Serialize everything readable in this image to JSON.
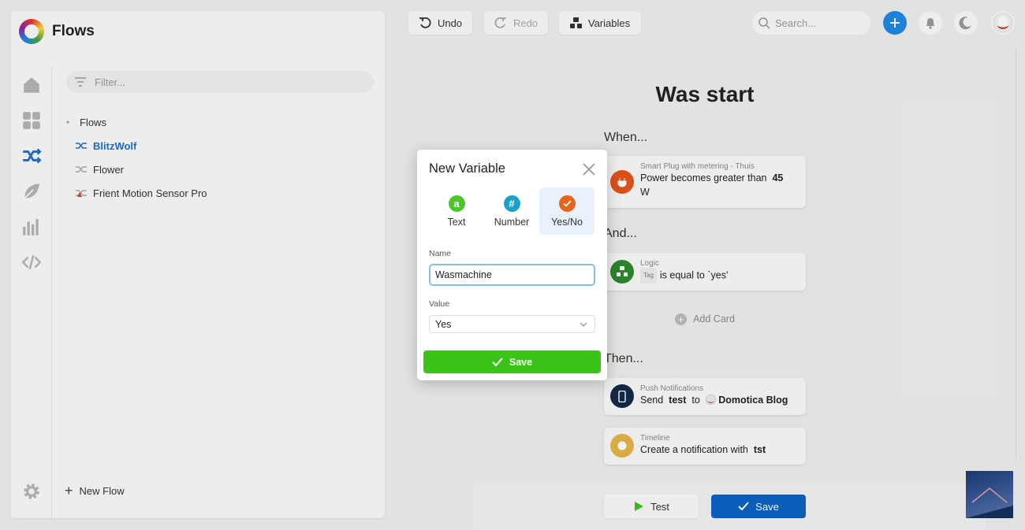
{
  "app": {
    "title": "Flows"
  },
  "sidebar": {
    "nav": [
      "home-icon",
      "dashboard-icon",
      "flows-icon",
      "energy-icon",
      "insights-icon",
      "devtools-icon"
    ],
    "settings": "gear-icon",
    "filter_placeholder": "Filter...",
    "tree_root": "Flows",
    "flows": [
      {
        "label": "BlitzWolf",
        "active": true
      },
      {
        "label": "Flower",
        "active": false
      },
      {
        "label": "Frient Motion Sensor Pro",
        "active": false
      }
    ],
    "new_flow_label": "New Flow"
  },
  "toolbar": {
    "undo_label": "Undo",
    "redo_label": "Redo",
    "variables_label": "Variables",
    "search_placeholder": "Search..."
  },
  "flow": {
    "title": "Was start",
    "when_label": "When...",
    "and_label": "And...",
    "then_label": "Then...",
    "when_card": {
      "sub": "Smart Plug with metering - Thuis",
      "text": "Power becomes greater than",
      "value": "45",
      "unit": "W"
    },
    "and_card": {
      "sub": "Logic",
      "tag": "Tag",
      "text": "is equal to `yes'"
    },
    "add_card_label": "Add Card",
    "then_cards": [
      {
        "sub": "Push Notifications",
        "pre": "Send",
        "bold1": "test",
        "mid": "to",
        "bold2": "Domotica Blog"
      },
      {
        "sub": "Timeline",
        "pre": "Create a notification with",
        "bold1": "tst"
      }
    ],
    "test_label": "Test",
    "save_label": "Save"
  },
  "dialog": {
    "title": "New Variable",
    "types": [
      {
        "label": "Text",
        "icon": "text-icon",
        "color": "#4cc72b"
      },
      {
        "label": "Number",
        "icon": "number-icon",
        "color": "#1aa3c9"
      },
      {
        "label": "Yes/No",
        "icon": "checkmark-icon",
        "color": "#e8641a",
        "selected": true
      }
    ],
    "name_label": "Name",
    "name_value": "Wasmachine",
    "value_label": "Value",
    "value_selected": "Yes",
    "save_label": "Save"
  },
  "colors": {
    "accent_blue": "#1f88e5",
    "save_blue": "#0b64c4",
    "save_green": "#3cc31a"
  }
}
